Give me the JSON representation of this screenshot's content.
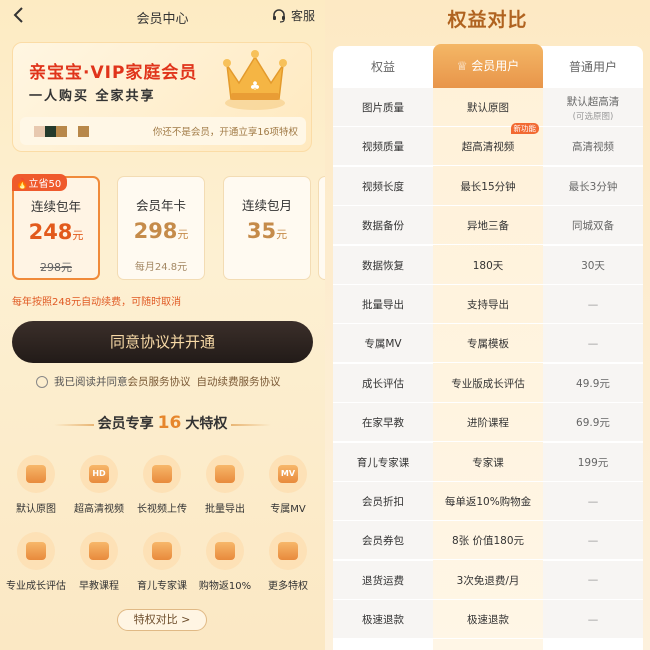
{
  "left": {
    "topbar": {
      "title": "会员中心",
      "service_label": "客服"
    },
    "vip_card": {
      "title": "亲宝宝·VIP家庭会员",
      "subtitle": "一人购买  全家共享",
      "notice": "你还不是会员，开通立享16项特权",
      "avatar_colors": [
        "#e8c9b0",
        "#243a2c",
        "#b8884a",
        "#fff7e6",
        "#b8884a"
      ]
    },
    "plans": [
      {
        "badge": "立省50",
        "name": "连续包年",
        "price": "248",
        "unit": "元",
        "note": "298元",
        "note_strike": true,
        "active": true
      },
      {
        "name": "会员年卡",
        "price": "298",
        "unit": "元",
        "note": "每月24.8元",
        "active": false
      },
      {
        "name": "连续包月",
        "price": "35",
        "unit": "元",
        "note": "",
        "active": false
      }
    ],
    "auto_note": "每年按照248元自动续费，可随时取消",
    "cta_label": "同意协议并开通",
    "agreement": {
      "prefix": "我已阅读并同意",
      "link1": "会员服务协议",
      "link2": "自动续费服务协议"
    },
    "privileges_title": {
      "prefix": "会员专享",
      "count": "16",
      "suffix": "大特权"
    },
    "features": [
      {
        "label": "默认原图",
        "icon": "photo-icon",
        "glyph": ""
      },
      {
        "label": "超高清视频",
        "icon": "hd-icon",
        "glyph": "HD"
      },
      {
        "label": "长视频上传",
        "icon": "video-upload-icon",
        "glyph": ""
      },
      {
        "label": "批量导出",
        "icon": "export-icon",
        "glyph": ""
      },
      {
        "label": "专属MV",
        "icon": "mv-icon",
        "glyph": "MV"
      },
      {
        "label": "专业成长评估",
        "icon": "assessment-icon",
        "glyph": ""
      },
      {
        "label": "早教课程",
        "icon": "course-icon",
        "glyph": ""
      },
      {
        "label": "育儿专家课",
        "icon": "expert-icon",
        "glyph": ""
      },
      {
        "label": "购物返10%",
        "icon": "cashback-icon",
        "glyph": ""
      },
      {
        "label": "更多特权",
        "icon": "more-icon",
        "glyph": ""
      }
    ],
    "compare_button": "特权对比 >"
  },
  "right": {
    "title": "权益对比",
    "headers": {
      "c1": "权益",
      "c2": "会员用户",
      "c3": "普通用户"
    },
    "rows": [
      {
        "name": "图片质量",
        "member": "默认原图",
        "normal": "默认超高清",
        "normal_sub": "(可选原图)"
      },
      {
        "name": "视频质量",
        "member": "超高清视频",
        "normal": "高清视频",
        "tag": "新功能"
      },
      {
        "name": "视频长度",
        "member": "最长15分钟",
        "normal": "最长3分钟"
      },
      {
        "name": "数据备份",
        "member": "异地三备",
        "normal": "同城双备"
      },
      {
        "name": "数据恢复",
        "member": "180天",
        "normal": "30天"
      },
      {
        "name": "批量导出",
        "member": "支持导出",
        "normal": "—"
      },
      {
        "name": "专属MV",
        "member": "专属模板",
        "normal": "—"
      },
      {
        "name": "成长评估",
        "member": "专业版成长评估",
        "normal": "49.9元"
      },
      {
        "name": "在家早教",
        "member": "进阶课程",
        "normal": "69.9元"
      },
      {
        "name": "育儿专家课",
        "member": "专家课",
        "normal": "199元"
      },
      {
        "name": "会员折扣",
        "member": "每单返10%购物金",
        "normal": "—"
      },
      {
        "name": "会员券包",
        "member": "8张 价值180元",
        "normal": "—"
      },
      {
        "name": "退货运费",
        "member": "3次免退费/月",
        "normal": "—"
      },
      {
        "name": "极速退款",
        "member": "极速退款",
        "normal": "—"
      }
    ]
  }
}
